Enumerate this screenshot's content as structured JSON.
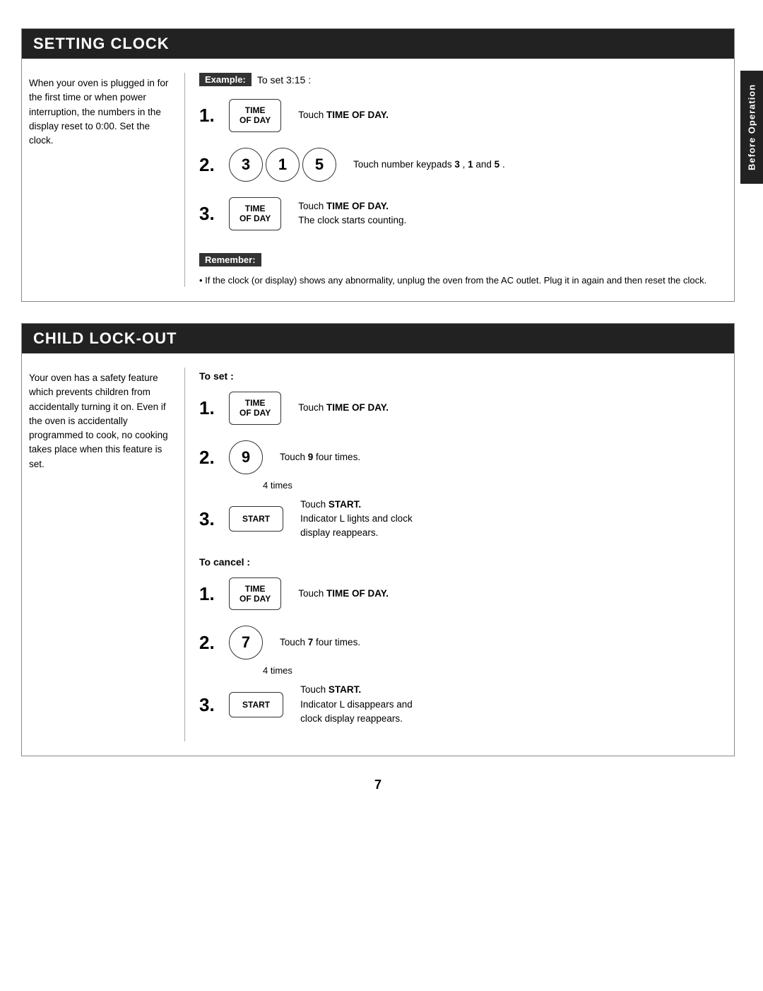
{
  "page": {
    "number": "7"
  },
  "side_tab": {
    "label": "Before Operation"
  },
  "setting_clock": {
    "header": "SETTING CLOCK",
    "left_text": "When your oven is plugged in for the first time or when power interruption, the numbers in the display reset to 0:00. Set the clock.",
    "example_label": "Example:",
    "example_text": "To set 3:15 :",
    "steps": [
      {
        "number": "1.",
        "button_label": "TIME\nOF DAY",
        "button_type": "rect",
        "description": "Touch TIME OF DAY."
      },
      {
        "number": "2.",
        "keypads": [
          "3",
          "1",
          "5"
        ],
        "description": "Touch number keypads 3 , 1 and 5 ."
      },
      {
        "number": "3.",
        "button_label": "TIME\nOF DAY",
        "button_type": "rect",
        "description": "Touch TIME OF DAY.\nThe clock starts counting."
      }
    ],
    "remember_label": "Remember:",
    "remember_text": "• If the clock (or display) shows any abnormality, unplug the oven from the AC outlet. Plug it in again and then reset the clock."
  },
  "child_lock_out": {
    "header": "CHILD LOCK-OUT",
    "left_text": "Your oven has a safety feature which prevents children from accidentally turning it on. Even if the oven is accidentally programmed to cook, no cooking takes place when this feature is set.",
    "to_set_label": "To set :",
    "set_steps": [
      {
        "number": "1.",
        "button_label": "TIME\nOF DAY",
        "button_type": "rect",
        "description": "Touch TIME OF DAY."
      },
      {
        "number": "2.",
        "button_label": "9",
        "button_type": "oval",
        "description": "Touch 9  four times.",
        "times_label": "4 times"
      },
      {
        "number": "3.",
        "button_label": "START",
        "button_type": "rect",
        "description": "Touch START.\nIndicator L lights and clock display reappears."
      }
    ],
    "to_cancel_label": "To cancel :",
    "cancel_steps": [
      {
        "number": "1.",
        "button_label": "TIME\nOF DAY",
        "button_type": "rect",
        "description": "Touch TIME OF DAY."
      },
      {
        "number": "2.",
        "button_label": "7",
        "button_type": "oval",
        "description": "Touch 7  four times.",
        "times_label": "4 times"
      },
      {
        "number": "3.",
        "button_label": "START",
        "button_type": "rect",
        "description": "Touch START.\nIndicator L disappears and clock display reappears."
      }
    ]
  }
}
